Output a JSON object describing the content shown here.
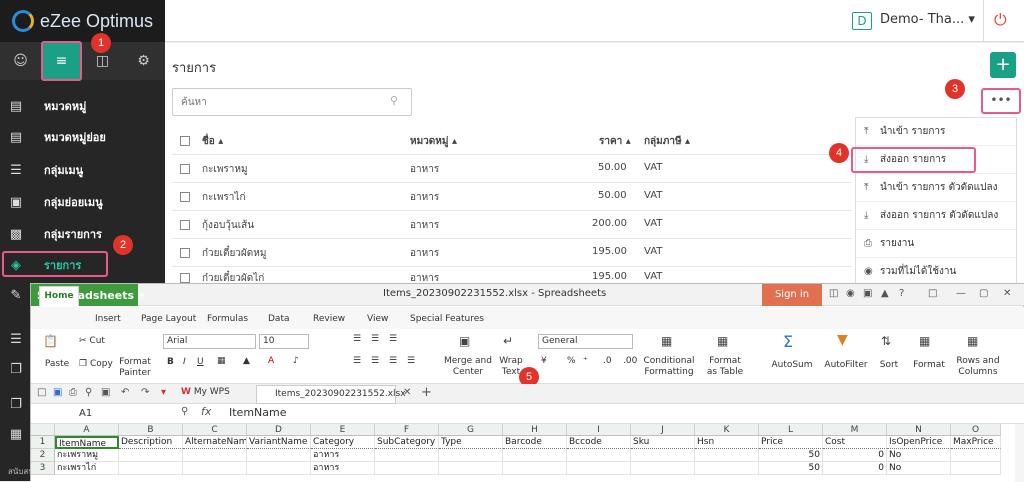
{
  "app": {
    "logo_text": "eZee Optimus",
    "company": "Demo- Tha...",
    "company_badge": "D"
  },
  "sidebar": {
    "items": [
      {
        "label": "หมวดหมู่"
      },
      {
        "label": "หมวดหมู่ย่อย"
      },
      {
        "label": "กลุ่มเมนู"
      },
      {
        "label": "กลุ่มย่อยเมนู"
      },
      {
        "label": "กลุ่มรายการ"
      },
      {
        "label": "รายการ"
      }
    ],
    "footer_text": "สนับสนุน"
  },
  "page": {
    "title": "รายการ",
    "search_placeholder": "ค้นหา",
    "add_label": "+",
    "more_label": "•••",
    "columns": [
      "ชื่อ ▴",
      "หมวดหมู่ ▴",
      "ราคา ▴",
      "กลุ่มภาษี ▴"
    ],
    "rows": [
      {
        "name": "กะเพราหมู",
        "category": "อาหาร",
        "price": "50.00",
        "tax": "VAT"
      },
      {
        "name": "กะเพราไก่",
        "category": "อาหาร",
        "price": "50.00",
        "tax": "VAT"
      },
      {
        "name": "กุ้งอบวุ้นเส้น",
        "category": "อาหาร",
        "price": "200.00",
        "tax": "VAT"
      },
      {
        "name": "ก๋วยเตี๋ยวผัดหมู",
        "category": "อาหาร",
        "price": "195.00",
        "tax": "VAT"
      },
      {
        "name": "ก๋วยเตี๋ยวผัดไก่",
        "category": "อาหาร",
        "price": "195.00",
        "tax": "VAT"
      }
    ]
  },
  "dropdown": {
    "items": [
      {
        "label": "นำเข้า รายการ",
        "icon": "⤒"
      },
      {
        "label": "ส่งออก รายการ",
        "icon": "⤓"
      },
      {
        "label": "นำเข้า รายการ ตัวดัดแปลง",
        "icon": "⤒"
      },
      {
        "label": "ส่งออก รายการ ตัวดัดแปลง",
        "icon": "⤓"
      },
      {
        "label": "รายงาน",
        "icon": "⎙"
      },
      {
        "label": "รวมที่ไม่ได้ใช้งาน",
        "icon": "◉"
      }
    ]
  },
  "badges": [
    "1",
    "2",
    "3",
    "4",
    "5"
  ],
  "spreadsheet": {
    "app_name": "Spreadsheets",
    "file_title": "Items_20230902231552.xlsx - Spreadsheets",
    "sign_in": "Sign in",
    "menus": [
      "Home",
      "Insert",
      "Page Layout",
      "Formulas",
      "Data",
      "Review",
      "View",
      "Special Features"
    ],
    "ribbon": {
      "paste": "Paste",
      "cut": "Cut",
      "copy": "Copy",
      "format_painter": "Format Painter",
      "font": "Arial",
      "size": "10",
      "merge": "Merge and Center",
      "wrap": "Wrap Text",
      "number_format": "General",
      "cond": "Conditional Formatting",
      "fmt_table": "Format as Table",
      "autosum": "AutoSum",
      "autofilter": "AutoFilter",
      "sort": "Sort",
      "format": "Format",
      "rows_cols": "Rows and Columns"
    },
    "qat": {
      "wps_tab": "My WPS",
      "doc_tab": "Items_20230902231552.xlsx"
    },
    "name_box": "A1",
    "formula_fx": "fx",
    "formula_value": "ItemName",
    "col_letters": [
      "A",
      "B",
      "C",
      "D",
      "E",
      "F",
      "G",
      "H",
      "I",
      "J",
      "K",
      "L",
      "M",
      "N",
      "O"
    ],
    "row_numbers": [
      "1",
      "2",
      "3"
    ],
    "header_row": [
      "ItemName",
      "Description",
      "AlternateNam",
      "VariantName",
      "Category",
      "SubCategory",
      "Type",
      "Barcode",
      "Bccode",
      "Sku",
      "Hsn",
      "Price",
      "Cost",
      "IsOpenPrice",
      "MaxPrice"
    ],
    "data_rows": [
      [
        "กะเพราหมู",
        "",
        "",
        "",
        "อาหาร",
        "",
        "",
        "",
        "",
        "",
        "",
        "50",
        "0",
        "No",
        ""
      ],
      [
        "กะเพราไก่",
        "",
        "",
        "",
        "อาหาร",
        "",
        "",
        "",
        "",
        "",
        "",
        "50",
        "0",
        "No",
        ""
      ]
    ]
  },
  "colors": {
    "accent": "#1aa085",
    "highlight": "#e85a8a",
    "badge": "#e2332b",
    "sheet_green": "#3d9b3d"
  }
}
